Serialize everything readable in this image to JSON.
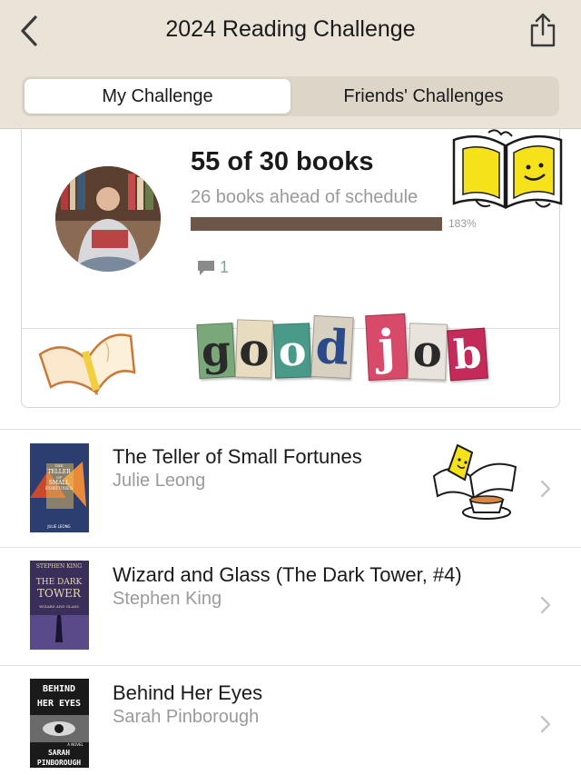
{
  "header": {
    "title": "2024 Reading Challenge",
    "back_icon": "chevron-left-icon",
    "share_icon": "share-icon"
  },
  "tabs": [
    {
      "label": "My Challenge",
      "active": true
    },
    {
      "label": "Friends' Challenges",
      "active": false
    }
  ],
  "challenge": {
    "count_text": "55 of 30 books",
    "ahead_text": "26 books ahead of schedule",
    "progress_percent": 183,
    "progress_label": "183%",
    "comment_count": "1",
    "sticker_text": "good job"
  },
  "books": [
    {
      "title": "The Teller of Small Fortunes",
      "author": "Julie Leong",
      "cover_lines": [
        "THE",
        "TELLER",
        "OF",
        "SMALL",
        "FORTUNES",
        "JULIE LEONG"
      ]
    },
    {
      "title": "Wizard and Glass (The Dark Tower, #4)",
      "author": "Stephen King",
      "cover_lines": [
        "STEPHEN KING",
        "THE DARK",
        "TOWER",
        "WIZARD AND GLASS"
      ]
    },
    {
      "title": "Behind Her Eyes",
      "author": "Sarah Pinborough",
      "cover_lines": [
        "BEHIND",
        "HER EYES",
        "A NOVEL",
        "SARAH",
        "PINBOROUGH"
      ]
    }
  ],
  "colors": {
    "header_bg": "#eae4d8",
    "progress_fill": "#6b5648",
    "comment_accent": "#7aa6a0"
  }
}
